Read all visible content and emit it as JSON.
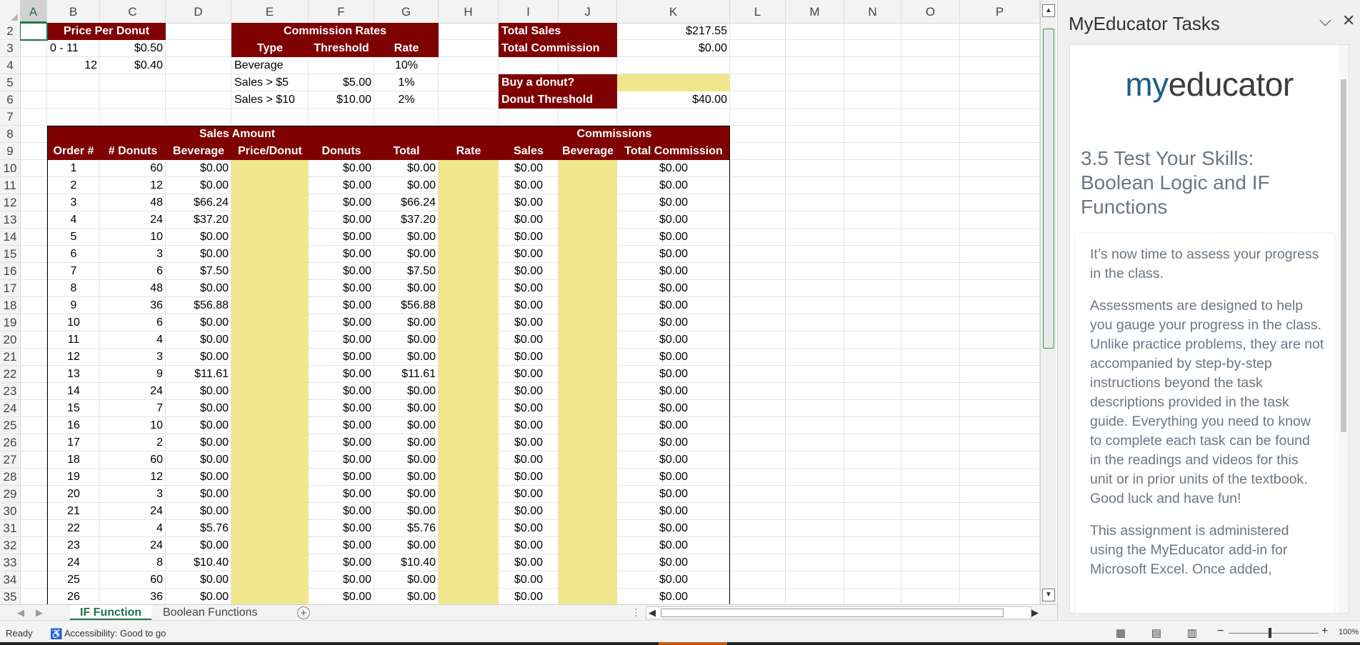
{
  "columns": [
    "A",
    "B",
    "C",
    "D",
    "E",
    "F",
    "G",
    "H",
    "I",
    "J",
    "K",
    "L",
    "M",
    "N",
    "O",
    "P"
  ],
  "rows": [
    2,
    3,
    4,
    5,
    6,
    7,
    8,
    9,
    10,
    11,
    12,
    13,
    14,
    15,
    16,
    17,
    18,
    19,
    20,
    21,
    22,
    23,
    24,
    25,
    26,
    27,
    28,
    29,
    30,
    31,
    32,
    33,
    34,
    35
  ],
  "price_table": {
    "header": "Price Per Donut",
    "rows": [
      {
        "range": "0 - 11",
        "price": "$0.50"
      },
      {
        "range": "12",
        "price": "$0.40"
      }
    ]
  },
  "commission_rates": {
    "header": "Commission Rates",
    "cols": [
      "Type",
      "Threshold",
      "Rate"
    ],
    "rows": [
      {
        "type": "Beverage",
        "threshold": "",
        "rate": "10%"
      },
      {
        "type": "Sales > $5",
        "threshold": "$5.00",
        "rate": "1%"
      },
      {
        "type": "Sales > $10",
        "threshold": "$10.00",
        "rate": "2%"
      }
    ]
  },
  "summary": {
    "total_sales_label": "Total Sales",
    "total_sales_value": "$217.55",
    "total_commission_label": "Total Commission",
    "total_commission_value": "$0.00",
    "buy_label": "Buy a donut?",
    "buy_value": "",
    "threshold_label": "Donut Threshold",
    "threshold_value": "$40.00"
  },
  "sales": {
    "group_header_sales": "Sales Amount",
    "group_header_commissions": "Commissions",
    "columns": [
      "Order #",
      "# Donuts",
      "Beverage",
      "Price/Donut",
      "Donuts",
      "Total",
      "Rate",
      "Sales",
      "Beverage",
      "Total Commission"
    ],
    "rows": [
      {
        "order": "1",
        "donuts": "60",
        "beverage": "$0.00",
        "donut_amt": "$0.00",
        "total": "$0.00"
      },
      {
        "order": "2",
        "donuts": "12",
        "beverage": "$0.00",
        "donut_amt": "$0.00",
        "total": "$0.00"
      },
      {
        "order": "3",
        "donuts": "48",
        "beverage": "$66.24",
        "donut_amt": "$0.00",
        "total": "$66.24"
      },
      {
        "order": "4",
        "donuts": "24",
        "beverage": "$37.20",
        "donut_amt": "$0.00",
        "total": "$37.20"
      },
      {
        "order": "5",
        "donuts": "10",
        "beverage": "$0.00",
        "donut_amt": "$0.00",
        "total": "$0.00"
      },
      {
        "order": "6",
        "donuts": "3",
        "beverage": "$0.00",
        "donut_amt": "$0.00",
        "total": "$0.00"
      },
      {
        "order": "7",
        "donuts": "6",
        "beverage": "$7.50",
        "donut_amt": "$0.00",
        "total": "$7.50"
      },
      {
        "order": "8",
        "donuts": "48",
        "beverage": "$0.00",
        "donut_amt": "$0.00",
        "total": "$0.00"
      },
      {
        "order": "9",
        "donuts": "36",
        "beverage": "$56.88",
        "donut_amt": "$0.00",
        "total": "$56.88"
      },
      {
        "order": "10",
        "donuts": "6",
        "beverage": "$0.00",
        "donut_amt": "$0.00",
        "total": "$0.00"
      },
      {
        "order": "11",
        "donuts": "4",
        "beverage": "$0.00",
        "donut_amt": "$0.00",
        "total": "$0.00"
      },
      {
        "order": "12",
        "donuts": "3",
        "beverage": "$0.00",
        "donut_amt": "$0.00",
        "total": "$0.00"
      },
      {
        "order": "13",
        "donuts": "9",
        "beverage": "$11.61",
        "donut_amt": "$0.00",
        "total": "$11.61"
      },
      {
        "order": "14",
        "donuts": "24",
        "beverage": "$0.00",
        "donut_amt": "$0.00",
        "total": "$0.00"
      },
      {
        "order": "15",
        "donuts": "7",
        "beverage": "$0.00",
        "donut_amt": "$0.00",
        "total": "$0.00"
      },
      {
        "order": "16",
        "donuts": "10",
        "beverage": "$0.00",
        "donut_amt": "$0.00",
        "total": "$0.00"
      },
      {
        "order": "17",
        "donuts": "2",
        "beverage": "$0.00",
        "donut_amt": "$0.00",
        "total": "$0.00"
      },
      {
        "order": "18",
        "donuts": "60",
        "beverage": "$0.00",
        "donut_amt": "$0.00",
        "total": "$0.00"
      },
      {
        "order": "19",
        "donuts": "12",
        "beverage": "$0.00",
        "donut_amt": "$0.00",
        "total": "$0.00"
      },
      {
        "order": "20",
        "donuts": "3",
        "beverage": "$0.00",
        "donut_amt": "$0.00",
        "total": "$0.00"
      },
      {
        "order": "21",
        "donuts": "24",
        "beverage": "$0.00",
        "donut_amt": "$0.00",
        "total": "$0.00"
      },
      {
        "order": "22",
        "donuts": "4",
        "beverage": "$5.76",
        "donut_amt": "$0.00",
        "total": "$5.76"
      },
      {
        "order": "23",
        "donuts": "24",
        "beverage": "$0.00",
        "donut_amt": "$0.00",
        "total": "$0.00"
      },
      {
        "order": "24",
        "donuts": "8",
        "beverage": "$10.40",
        "donut_amt": "$0.00",
        "total": "$10.40"
      },
      {
        "order": "25",
        "donuts": "60",
        "beverage": "$0.00",
        "donut_amt": "$0.00",
        "total": "$0.00"
      },
      {
        "order": "26",
        "donuts": "36",
        "beverage": "$0.00",
        "donut_amt": "$0.00",
        "total": "$0.00"
      }
    ],
    "commission_sales": "$0.00",
    "commission_total": "$0.00"
  },
  "tabs": [
    "IF Function",
    "Boolean Functions"
  ],
  "active_tab": "IF Function",
  "status": {
    "ready": "Ready",
    "accessibility": "Accessibility: Good to go",
    "zoom": "100%"
  },
  "pane": {
    "title": "MyEducator Tasks",
    "logo_prefix": "my",
    "logo_word": "educator",
    "heading": "3.5 Test Your Skills: Boolean Logic and IF Functions",
    "paragraphs": [
      "It’s now time to assess your progress in the class.",
      "Assessments are designed to help you gauge your progress in the class. Unlike practice problems, they are not accompanied by step-by-step instructions beyond the task descriptions provided in the task guide. Everything you need to know to complete each task can be found in the readings and videos for this unit or in prior units of the textbook. Good luck and have fun!",
      "This assignment is administered using the MyEducator add-in for Microsoft Excel. Once added,"
    ]
  },
  "colors": {
    "header_fill": "#7f0000",
    "input_fill": "#f0e68c",
    "excel_green": "#217346"
  }
}
